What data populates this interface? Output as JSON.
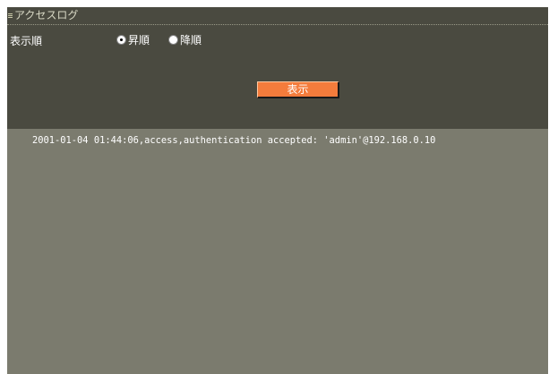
{
  "window": {
    "title": "アクセスログ"
  },
  "controls": {
    "order_label": "表示順",
    "options": [
      {
        "label": "昇順",
        "checked": true
      },
      {
        "label": "降順",
        "checked": false
      }
    ],
    "show_button_label": "表示"
  },
  "log": {
    "lines": [
      "2001-01-04 01:44:06,access,authentication accepted: 'admin'@192.168.0.10"
    ]
  },
  "colors": {
    "panel_bg": "#4a4a40",
    "log_bg": "#7b7b6e",
    "button_bg": "#f47c3c",
    "text": "#ffffff"
  }
}
